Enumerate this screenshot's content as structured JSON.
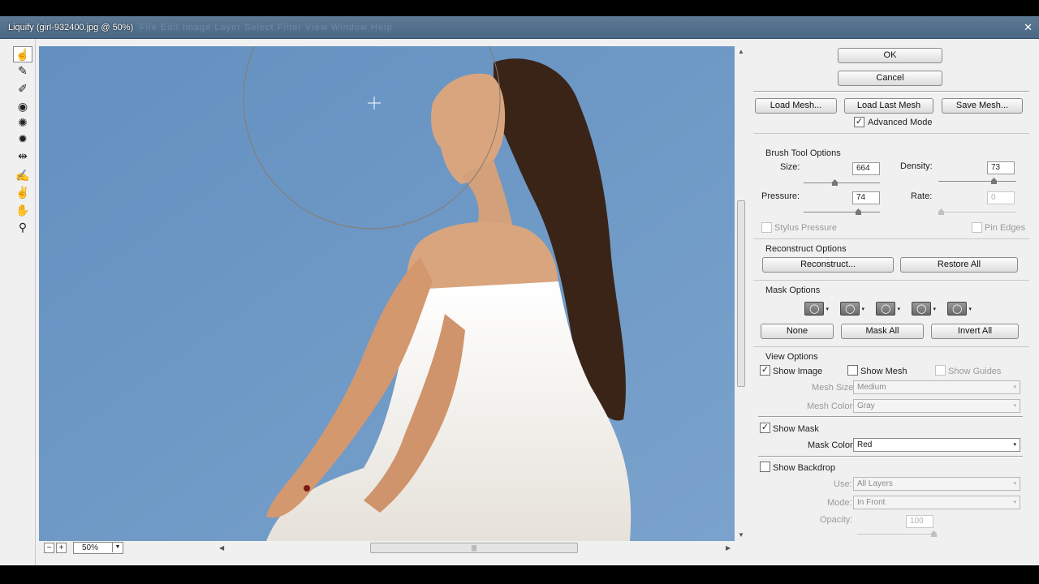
{
  "window": {
    "title": "Liquify (girl-932400.jpg @ 50%)",
    "ghost_menu": "File   Edit   Image   Layer   Select   Filter   View   Window   Help",
    "close_glyph": "✕"
  },
  "tools": [
    {
      "name": "forward-warp-tool-icon",
      "glyph": "☝"
    },
    {
      "name": "reconstruct-tool-icon",
      "glyph": "✎"
    },
    {
      "name": "smooth-tool-icon",
      "glyph": "✐"
    },
    {
      "name": "twirl-tool-icon",
      "glyph": "◉"
    },
    {
      "name": "pucker-tool-icon",
      "glyph": "✺"
    },
    {
      "name": "bloat-tool-icon",
      "glyph": "✹"
    },
    {
      "name": "push-left-tool-icon",
      "glyph": "⇹"
    },
    {
      "name": "freeze-mask-tool-icon",
      "glyph": "✍"
    },
    {
      "name": "thaw-mask-tool-icon",
      "glyph": "✌"
    },
    {
      "name": "hand-tool-icon",
      "glyph": "✋"
    },
    {
      "name": "zoom-tool-icon",
      "glyph": "⚲"
    }
  ],
  "zoom": {
    "minus": "−",
    "plus": "+",
    "value": "50%",
    "dropdown": "▼"
  },
  "buttons": {
    "ok": "OK",
    "cancel": "Cancel",
    "load_mesh": "Load Mesh...",
    "load_last_mesh": "Load Last Mesh",
    "save_mesh": "Save Mesh...",
    "reconstruct": "Reconstruct...",
    "restore_all": "Restore All",
    "none": "None",
    "mask_all": "Mask All",
    "invert_all": "Invert All"
  },
  "advanced_mode": {
    "label": "Advanced Mode",
    "checked": true
  },
  "brush": {
    "section": "Brush Tool Options",
    "size_label": "Size:",
    "size": "664",
    "size_level": 0.4,
    "density_label": "Density:",
    "density": "73",
    "density_level": 0.73,
    "pressure_label": "Pressure:",
    "pressure": "74",
    "pressure_level": 0.74,
    "rate_label": "Rate:",
    "rate": "0",
    "rate_level": 0,
    "stylus_label": "Stylus Pressure",
    "pin_label": "Pin Edges"
  },
  "reconstruct": {
    "section": "Reconstruct Options"
  },
  "mask": {
    "section": "Mask Options",
    "icons": [
      "replace-selection-icon",
      "add-to-selection-icon",
      "subtract-from-selection-icon",
      "intersect-with-selection-icon",
      "invert-selection-icon"
    ],
    "icon_glyph": "◯",
    "tri": "▾"
  },
  "view": {
    "section": "View Options",
    "show_image": "Show Image",
    "show_mesh": "Show Mesh",
    "show_guides": "Show Guides",
    "mesh_size_label": "Mesh Size:",
    "mesh_size": "Medium",
    "mesh_color_label": "Mesh Color:",
    "mesh_color": "Gray",
    "show_mask": "Show Mask",
    "mask_color_label": "Mask Color:",
    "mask_color": "Red",
    "show_backdrop": "Show Backdrop",
    "use_label": "Use:",
    "use": "All Layers",
    "mode_label": "Mode:",
    "mode": "In Front",
    "opacity_label": "Opacity:",
    "opacity": "100",
    "opacity_level": 1.0,
    "check": "✓",
    "dd": "▾"
  },
  "colors": {
    "sky": "#6e98c4",
    "dress": "#f4f1ea",
    "hair": "#3a2418",
    "skin": "#d9a57e"
  }
}
